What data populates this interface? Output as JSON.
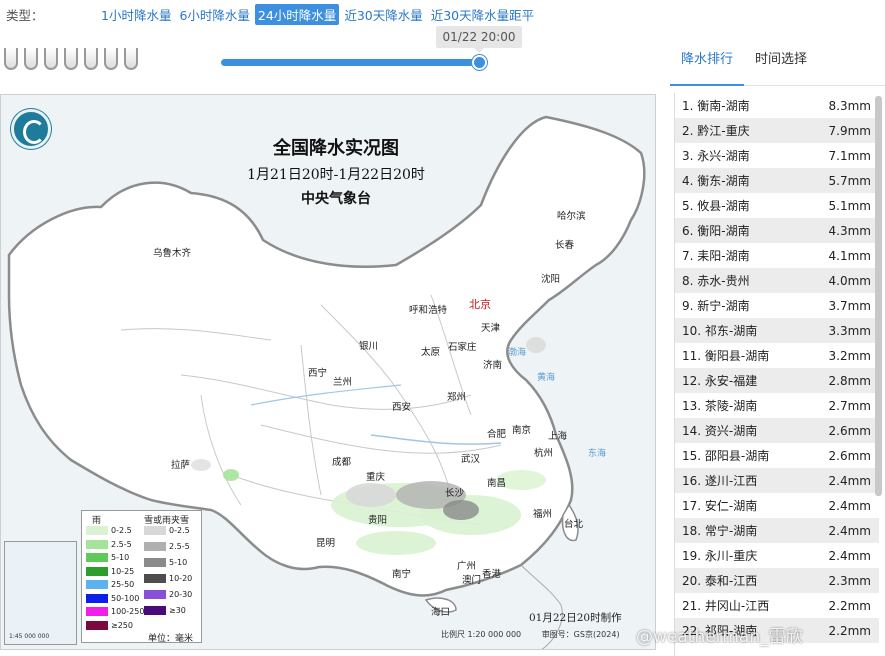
{
  "typebar": {
    "label": "类型：",
    "tabs": [
      "1小时降水量",
      "6小时降水量",
      "24小时降水量",
      "近30天降水量",
      "近30天降水量距平"
    ],
    "active_index": 2
  },
  "slider": {
    "time_label": "01/22 20:00",
    "progress": 1.0
  },
  "map": {
    "title": "全国降水实况图",
    "subtitle": "1月21日20时-1月22日20时",
    "agency": "中央气象台",
    "cities": {
      "urumqi": "乌鲁木齐",
      "harbin": "哈尔滨",
      "changchun": "长春",
      "shenyang": "沈阳",
      "beijing": "北京",
      "tianjin": "天津",
      "hohhot": "呼和浩特",
      "yinchuan": "银川",
      "taiyuan": "太原",
      "shijiazhuang": "石家庄",
      "jinan": "济南",
      "xining": "西宁",
      "lanzhou": "兰州",
      "xian": "西安",
      "zhengzhou": "郑州",
      "hefei": "合肥",
      "nanjing": "南京",
      "shanghai": "上海",
      "hangzhou": "杭州",
      "wuhan": "武汉",
      "lhasa": "拉萨",
      "chengdu": "成都",
      "chongqing": "重庆",
      "changsha": "长沙",
      "nanchang": "南昌",
      "fuzhou": "福州",
      "taipei": "台北",
      "guiyang": "贵阳",
      "kunming": "昆明",
      "nanning": "南宁",
      "guangzhou": "广州",
      "hongkong": "香港",
      "macao": "澳门",
      "haikou": "海口"
    },
    "seas": {
      "bohai": "渤海",
      "yellow": "黄海",
      "east": "东海"
    },
    "legend": {
      "rain_header": "雨",
      "snow_header": "雪或雨夹雪",
      "rain": [
        {
          "label": "0-2.5",
          "color": "#d9f2d0"
        },
        {
          "label": "2.5-5",
          "color": "#a6e39a"
        },
        {
          "label": "5-10",
          "color": "#5fc95a"
        },
        {
          "label": "10-25",
          "color": "#2c9e2c"
        },
        {
          "label": "25-50",
          "color": "#5ab2ef"
        },
        {
          "label": "50-100",
          "color": "#0a1fe8"
        },
        {
          "label": "100-250",
          "color": "#ef1fe9"
        },
        {
          "label": "≥250",
          "color": "#7d0a3c"
        }
      ],
      "snow": [
        {
          "label": "0-2.5",
          "color": "#d8d8d8"
        },
        {
          "label": "2.5-5",
          "color": "#b0b0b0"
        },
        {
          "label": "5-10",
          "color": "#8a8a8a"
        },
        {
          "label": "10-20",
          "color": "#4d4d4d"
        },
        {
          "label": "20-30",
          "color": "#8a4fd8"
        },
        {
          "label": "≥30",
          "color": "#4b0a7a"
        }
      ],
      "unit": "单位：毫米"
    },
    "made_by": "01月22日20时制作",
    "scale": "比例尺 1:20 000 000",
    "review_no": "审图号：GS京(2024)",
    "inset_scale": "1:45 000 000"
  },
  "watermark": "@weatherman_雷欣",
  "right_panel": {
    "tabs": [
      "降水排行",
      "时间选择"
    ],
    "active_tab": 0,
    "ranking": [
      {
        "name": "1. 衡南-湖南",
        "value": "8.3mm"
      },
      {
        "name": "2. 黔江-重庆",
        "value": "7.9mm"
      },
      {
        "name": "3. 永兴-湖南",
        "value": "7.1mm"
      },
      {
        "name": "4. 衡东-湖南",
        "value": "5.7mm"
      },
      {
        "name": "5. 攸县-湖南",
        "value": "5.1mm"
      },
      {
        "name": "6. 衡阳-湖南",
        "value": "4.3mm"
      },
      {
        "name": "7. 耒阳-湖南",
        "value": "4.1mm"
      },
      {
        "name": "8. 赤水-贵州",
        "value": "4.0mm"
      },
      {
        "name": "9. 新宁-湖南",
        "value": "3.7mm"
      },
      {
        "name": "10. 祁东-湖南",
        "value": "3.3mm"
      },
      {
        "name": "11. 衡阳县-湖南",
        "value": "3.2mm"
      },
      {
        "name": "12. 永安-福建",
        "value": "2.8mm"
      },
      {
        "name": "13. 茶陵-湖南",
        "value": "2.7mm"
      },
      {
        "name": "14. 资兴-湖南",
        "value": "2.6mm"
      },
      {
        "name": "15. 邵阳县-湖南",
        "value": "2.6mm"
      },
      {
        "name": "16. 遂川-江西",
        "value": "2.4mm"
      },
      {
        "name": "17. 安仁-湖南",
        "value": "2.4mm"
      },
      {
        "name": "18. 常宁-湖南",
        "value": "2.4mm"
      },
      {
        "name": "19. 永川-重庆",
        "value": "2.4mm"
      },
      {
        "name": "20. 泰和-江西",
        "value": "2.3mm"
      },
      {
        "name": "21. 井冈山-江西",
        "value": "2.2mm"
      },
      {
        "name": "22. 祁阳-湖南",
        "value": "2.2mm"
      }
    ]
  }
}
